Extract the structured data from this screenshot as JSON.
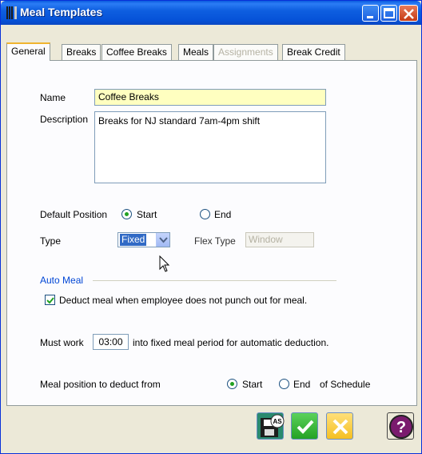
{
  "window": {
    "title": "Meal Templates",
    "icons": {
      "app": "fork-knife-icon",
      "minimize": "minimize-icon",
      "maximize": "maximize-icon",
      "close": "close-icon"
    }
  },
  "tabs": [
    {
      "label": "General",
      "active": true
    },
    {
      "label": "Breaks"
    },
    {
      "label": "Coffee Breaks"
    },
    {
      "label": "Meals"
    },
    {
      "label": "Assignments",
      "disabled": true
    },
    {
      "label": "Break Credit"
    }
  ],
  "form": {
    "name_label": "Name",
    "name_value": "Coffee Breaks",
    "description_label": "Description",
    "description_value": "Breaks for NJ standard 7am-4pm shift",
    "default_position_label": "Default Position",
    "default_position_start": "Start",
    "default_position_end": "End",
    "type_label": "Type",
    "type_value": "Fixed",
    "flex_type_label": "Flex Type",
    "flex_type_value": "Window"
  },
  "auto_meal": {
    "section_title": "Auto Meal",
    "deduct_checkbox_label": "Deduct meal when employee does not punch out for meal.",
    "deduct_checked": true,
    "must_work_prefix": "Must work",
    "must_work_value": "03:00",
    "must_work_suffix": "into fixed meal period for automatic deduction.",
    "meal_position_label": "Meal position to deduct from",
    "meal_position_start": "Start",
    "meal_position_end": "End",
    "meal_position_suffix": "of Schedule"
  },
  "buttons": {
    "save_as_icon": "save-as-icon",
    "save_as_badge": "AS",
    "ok_icon": "checkmark-icon",
    "cancel_icon": "cancel-x-icon",
    "help_icon": "help-question-icon"
  },
  "colors": {
    "titlebar": "#0a5bdf",
    "name_field_bg": "#ffffc0",
    "section_title": "#0046d5",
    "ok_button": "#2fa82f",
    "cancel_button": "#f5c022",
    "help_button": "#7a1a6e"
  }
}
